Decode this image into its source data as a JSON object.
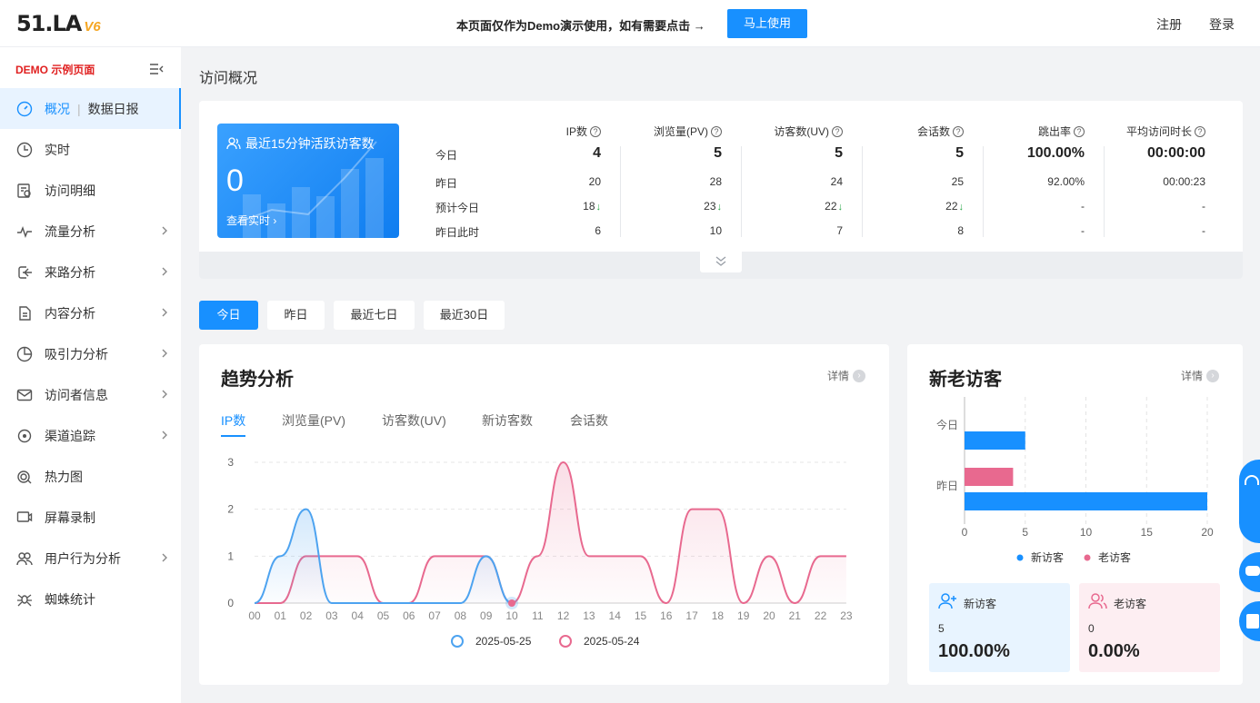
{
  "topbar": {
    "logo_text": "51.LA",
    "logo_version": "V6",
    "notice": "本页面仅作为Demo演示使用，如有需要点击 →",
    "try_button": "马上使用",
    "register": "注册",
    "login": "登录"
  },
  "sidebar": {
    "demo_label": "DEMO 示例页面",
    "items": [
      {
        "label": "概况",
        "extra": "数据日报",
        "icon": "dashboard-icon",
        "active": true,
        "chevron": false
      },
      {
        "label": "实时",
        "icon": "clock-icon",
        "chevron": false
      },
      {
        "label": "访问明细",
        "icon": "detail-list-icon",
        "chevron": false
      },
      {
        "label": "流量分析",
        "icon": "pulse-icon",
        "chevron": true
      },
      {
        "label": "来路分析",
        "icon": "source-icon",
        "chevron": true
      },
      {
        "label": "内容分析",
        "icon": "document-icon",
        "chevron": true
      },
      {
        "label": "吸引力分析",
        "icon": "pie-icon",
        "chevron": true
      },
      {
        "label": "访问者信息",
        "icon": "mail-icon",
        "chevron": true
      },
      {
        "label": "渠道追踪",
        "icon": "target-icon",
        "chevron": true
      },
      {
        "label": "热力图",
        "icon": "heatmap-icon",
        "chevron": false
      },
      {
        "label": "屏幕录制",
        "icon": "screen-record-icon",
        "chevron": false
      },
      {
        "label": "用户行为分析",
        "icon": "users-icon",
        "chevron": true
      },
      {
        "label": "蜘蛛统计",
        "icon": "spider-icon",
        "chevron": false
      }
    ]
  },
  "page_title": "访问概况",
  "live": {
    "title": "最近15分钟活跃访客数",
    "value": "0",
    "link": "查看实时"
  },
  "stats": {
    "row_labels": [
      "今日",
      "昨日",
      "预计今日",
      "昨日此时"
    ],
    "columns": [
      {
        "header": "IP数",
        "values": [
          "4",
          "20",
          "18",
          "6"
        ],
        "down": true
      },
      {
        "header": "浏览量(PV)",
        "values": [
          "5",
          "28",
          "23",
          "10"
        ],
        "down": true
      },
      {
        "header": "访客数(UV)",
        "values": [
          "5",
          "24",
          "22",
          "7"
        ],
        "down": true
      },
      {
        "header": "会话数",
        "values": [
          "5",
          "25",
          "22",
          "8"
        ],
        "down": true
      },
      {
        "header": "跳出率",
        "values": [
          "100.00%",
          "92.00%",
          "-",
          "-"
        ],
        "down": false
      },
      {
        "header": "平均访问时长",
        "values": [
          "00:00:00",
          "00:00:23",
          "-",
          "-"
        ],
        "down": false
      }
    ]
  },
  "period_tabs": [
    "今日",
    "昨日",
    "最近七日",
    "最近30日"
  ],
  "trend": {
    "title": "趋势分析",
    "detail": "详情",
    "metric_tabs": [
      "IP数",
      "浏览量(PV)",
      "访客数(UV)",
      "新访客数",
      "会话数"
    ]
  },
  "new_old": {
    "title": "新老访客",
    "detail": "详情",
    "new_label": "新访客",
    "new_count": "5",
    "new_pct": "100.00%",
    "old_label": "老访客",
    "old_count": "0",
    "old_pct": "0.00%"
  },
  "colors": {
    "accent": "#1890ff",
    "series_today": "#4da3f0",
    "series_yesterday": "#e8698f"
  },
  "chart_data": [
    {
      "type": "line",
      "x": [
        "00",
        "01",
        "02",
        "03",
        "04",
        "05",
        "06",
        "07",
        "08",
        "09",
        "10",
        "11",
        "12",
        "13",
        "14",
        "15",
        "16",
        "17",
        "18",
        "19",
        "20",
        "21",
        "22",
        "23"
      ],
      "series": [
        {
          "name": "2025-05-25",
          "values": [
            0,
            1,
            2,
            0,
            0,
            0,
            0,
            0,
            0,
            1,
            0,
            null,
            null,
            null,
            null,
            null,
            null,
            null,
            null,
            null,
            null,
            null,
            null,
            null
          ]
        },
        {
          "name": "2025-05-24",
          "values": [
            0,
            0,
            1,
            1,
            1,
            0,
            0,
            1,
            1,
            1,
            0,
            1,
            3,
            1,
            1,
            1,
            0,
            2,
            2,
            0,
            1,
            0,
            1,
            1
          ]
        }
      ],
      "yticks": [
        "0",
        "1",
        "2",
        "3"
      ],
      "ylim": [
        0,
        3
      ],
      "legend": "bottom"
    },
    {
      "type": "bar",
      "orientation": "horizontal",
      "categories": [
        "今日",
        "昨日"
      ],
      "series": [
        {
          "name": "新访客",
          "values": [
            5,
            20
          ]
        },
        {
          "name": "老访客",
          "values": [
            0,
            4
          ]
        }
      ],
      "xticks": [
        "0",
        "5",
        "10",
        "15",
        "20"
      ],
      "xlim": [
        0,
        20
      ],
      "legend": "bottom"
    }
  ]
}
